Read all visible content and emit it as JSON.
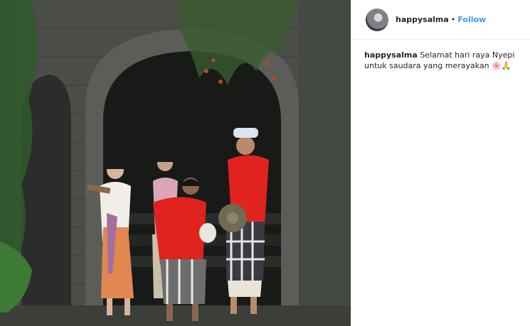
{
  "post": {
    "author": {
      "username": "happysalma",
      "separator": "•",
      "follow_label": "Follow"
    },
    "caption": {
      "username": "happysalma",
      "text": "Selamat hari raya Nyepi untuk saudara yang merayakan",
      "emojis": [
        "🌸",
        "🙏"
      ]
    }
  },
  "colors": {
    "follow": "#3897f0",
    "text": "#262626",
    "divider": "#efefef"
  },
  "icons": {
    "avatar": "profile-avatar"
  }
}
